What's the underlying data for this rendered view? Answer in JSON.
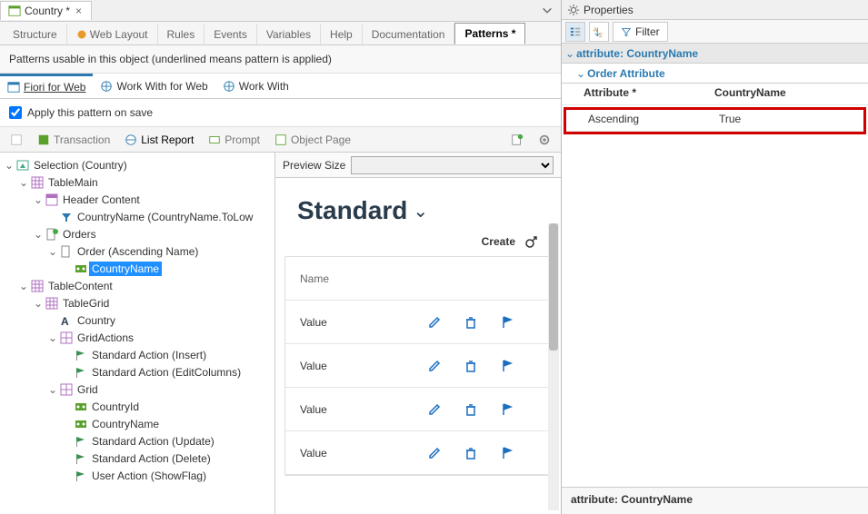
{
  "tabBar": {
    "title": "Country *"
  },
  "secTabs": [
    "Structure",
    "Web Layout",
    "Rules",
    "Events",
    "Variables",
    "Help",
    "Documentation",
    "Patterns *"
  ],
  "secActiveIndex": 7,
  "descBar": "Patterns usable in this object (underlined means pattern is applied)",
  "fioriTabs": [
    {
      "label": "Fiori for Web",
      "active": true
    },
    {
      "label": "Work With for Web",
      "active": false
    },
    {
      "label": "Work With",
      "active": false
    }
  ],
  "applyLabel": "Apply this pattern on save",
  "applyChecked": true,
  "toolbar": [
    "Transaction",
    "List Report",
    "Prompt",
    "Object Page"
  ],
  "toolbarActiveIndex": 1,
  "tree": {
    "root": "Selection (Country)",
    "n_tablemain": "TableMain",
    "n_headercontent": "Header Content",
    "n_countryname_filter": "CountryName (CountryName.ToLow",
    "n_orders": "Orders",
    "n_order": "Order (Ascending Name)",
    "n_countryname": "CountryName",
    "n_tablecontent": "TableContent",
    "n_tablegrid": "TableGrid",
    "n_country": "Country",
    "n_gridactions": "GridActions",
    "n_sa_insert": "Standard Action (Insert)",
    "n_sa_editcols": "Standard Action (EditColumns)",
    "n_grid": "Grid",
    "n_countryid": "CountryId",
    "n_countryname2": "CountryName",
    "n_sa_update": "Standard Action (Update)",
    "n_sa_delete": "Standard Action (Delete)",
    "n_ua_showflag": "User Action (ShowFlag)"
  },
  "preview": {
    "sizeLabel": "Preview Size",
    "title": "Standard",
    "createLabel": "Create",
    "headerName": "Name",
    "rowLabel": "Value"
  },
  "properties": {
    "title": "Properties",
    "filterLabel": "Filter",
    "groupTitle": "attribute: CountryName",
    "subGroupTitle": "Order Attribute",
    "rows": [
      {
        "key": "Attribute *",
        "value": "CountryName"
      },
      {
        "key": "Ascending",
        "value": "True"
      }
    ],
    "status": "attribute: CountryName"
  }
}
